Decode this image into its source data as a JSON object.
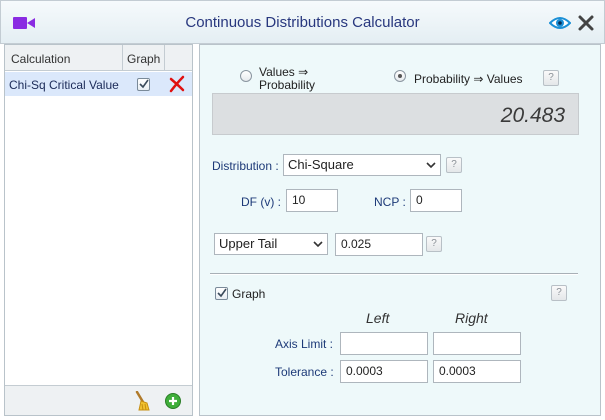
{
  "window": {
    "title": "Continuous Distributions Calculator",
    "icons": [
      "camera-icon",
      "eye-icon",
      "close-icon"
    ],
    "accent_color": "#8a2be2"
  },
  "calc_list": {
    "headers": {
      "calculation": "Calculation",
      "graph": "Graph"
    },
    "rows": [
      {
        "label": "Chi-Sq Critical Value",
        "graph_checked": true
      }
    ],
    "footer_icons": [
      "broom-icon",
      "add-icon"
    ]
  },
  "mode": {
    "option_values_to_probability": "Values ⇒ Probability",
    "option_probability_to_values": "Probability ⇒ Values",
    "selected": "Probability ⇒ Values",
    "help": "?"
  },
  "result": {
    "value": "20.483"
  },
  "distribution": {
    "label": "Distribution :",
    "selected": "Chi-Square",
    "help": "?"
  },
  "params": {
    "df_label": "DF (v) :",
    "df_value": "10",
    "ncp_label": "NCP :",
    "ncp_value": "0"
  },
  "tail": {
    "selected": "Upper Tail",
    "probability": "0.025",
    "help": "?"
  },
  "graph": {
    "label": "Graph",
    "checked": true,
    "help": "?",
    "col_left": "Left",
    "col_right": "Right",
    "axis_limit_label": "Axis Limit :",
    "axis_limit_left": "",
    "axis_limit_right": "",
    "tolerance_label": "Tolerance :",
    "tolerance_left": "0.0003",
    "tolerance_right": "0.0003"
  }
}
